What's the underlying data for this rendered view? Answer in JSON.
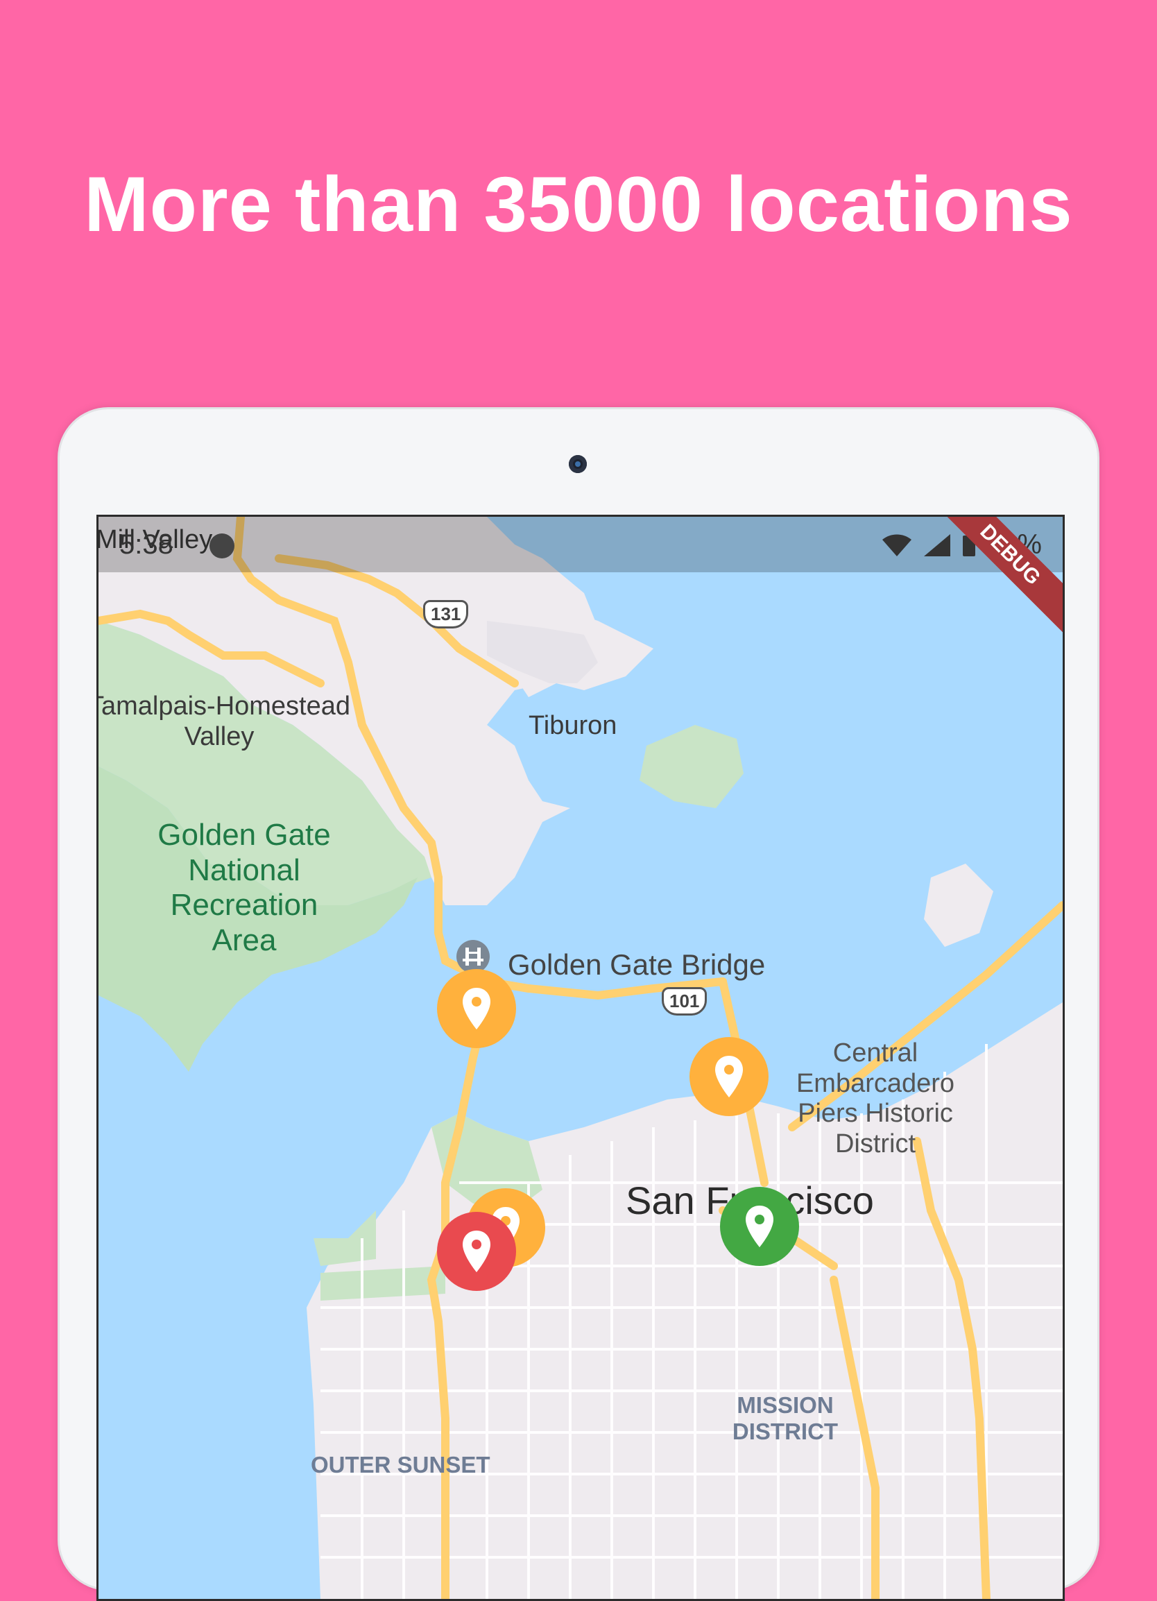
{
  "headline": "More than 35000 locations",
  "status_bar": {
    "time": "5:38",
    "battery": "88%",
    "debug_banner": "DEBUG"
  },
  "map": {
    "town_labels": [
      "Mill Valley",
      "Tamalpais-Homestead Valley",
      "Tiburon"
    ],
    "park_label": "Golden Gate National Recreation Area",
    "landmarks": [
      "Golden Gate Bridge",
      "Central Embarcadero Piers Historic District"
    ],
    "city": "San Francisco",
    "districts": [
      "MISSION DISTRICT",
      "OUTER SUNSET"
    ],
    "route_shields": [
      "131",
      "101"
    ]
  },
  "marker_colors": {
    "orange": "#FFB13D",
    "green": "#43A843",
    "red": "#E94A4F"
  }
}
